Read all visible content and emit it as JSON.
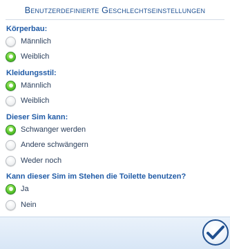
{
  "dialog": {
    "title": "Benutzerdefinierte Geschlechtseinstellungen",
    "sections": [
      {
        "label": "Körperbau:",
        "options": [
          {
            "label": "Männlich",
            "selected": false
          },
          {
            "label": "Weiblich",
            "selected": true
          }
        ]
      },
      {
        "label": "Kleidungsstil:",
        "options": [
          {
            "label": "Männlich",
            "selected": true
          },
          {
            "label": "Weiblich",
            "selected": false
          }
        ]
      },
      {
        "label": "Dieser Sim kann:",
        "options": [
          {
            "label": "Schwanger werden",
            "selected": true
          },
          {
            "label": "Andere schwängern",
            "selected": false
          },
          {
            "label": "Weder noch",
            "selected": false
          }
        ]
      },
      {
        "label": "Kann dieser Sim im Stehen die Toilette benutzen?",
        "options": [
          {
            "label": "Ja",
            "selected": true
          },
          {
            "label": "Nein",
            "selected": false
          }
        ]
      }
    ],
    "confirm_icon": "checkmark-icon",
    "colors": {
      "accent": "#1f5aa6",
      "selected_radio": "#5ec92d",
      "footer": "#dce8f6"
    }
  }
}
